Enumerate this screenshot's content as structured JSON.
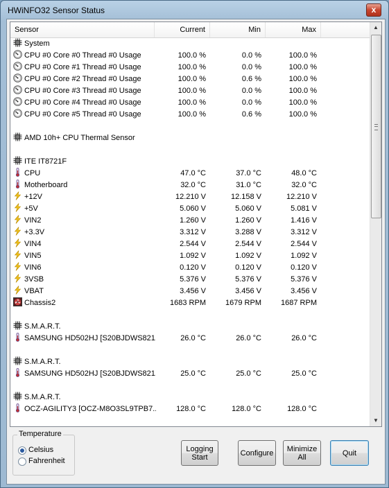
{
  "window": {
    "title": "HWiNFO32 Sensor Status",
    "close_glyph": "x"
  },
  "columns": {
    "sensor": "Sensor",
    "current": "Current",
    "min": "Min",
    "max": "Max"
  },
  "rows": [
    {
      "type": "group",
      "icon": "chip-icon",
      "name": "System",
      "current": "",
      "min": "",
      "max": ""
    },
    {
      "type": "item",
      "icon": "gauge-icon",
      "name": "CPU #0 Core #0 Thread #0 Usage",
      "current": "100.0 %",
      "min": "0.0 %",
      "max": "100.0 %"
    },
    {
      "type": "item",
      "icon": "gauge-icon",
      "name": "CPU #0 Core #1 Thread #0 Usage",
      "current": "100.0 %",
      "min": "0.0 %",
      "max": "100.0 %"
    },
    {
      "type": "item",
      "icon": "gauge-icon",
      "name": "CPU #0 Core #2 Thread #0 Usage",
      "current": "100.0 %",
      "min": "0.6 %",
      "max": "100.0 %"
    },
    {
      "type": "item",
      "icon": "gauge-icon",
      "name": "CPU #0 Core #3 Thread #0 Usage",
      "current": "100.0 %",
      "min": "0.0 %",
      "max": "100.0 %"
    },
    {
      "type": "item",
      "icon": "gauge-icon",
      "name": "CPU #0 Core #4 Thread #0 Usage",
      "current": "100.0 %",
      "min": "0.0 %",
      "max": "100.0 %"
    },
    {
      "type": "item",
      "icon": "gauge-icon",
      "name": "CPU #0 Core #5 Thread #0 Usage",
      "current": "100.0 %",
      "min": "0.6 %",
      "max": "100.0 %"
    },
    {
      "type": "blank",
      "icon": "",
      "name": "",
      "current": "",
      "min": "",
      "max": ""
    },
    {
      "type": "group",
      "icon": "chip-icon",
      "name": "AMD 10h+ CPU Thermal Sensor",
      "current": "",
      "min": "",
      "max": ""
    },
    {
      "type": "blank",
      "icon": "",
      "name": "",
      "current": "",
      "min": "",
      "max": ""
    },
    {
      "type": "group",
      "icon": "chip-icon",
      "name": "ITE IT8721F",
      "current": "",
      "min": "",
      "max": ""
    },
    {
      "type": "item",
      "icon": "thermometer-icon",
      "name": "CPU",
      "current": "47.0 °C",
      "min": "37.0 °C",
      "max": "48.0 °C"
    },
    {
      "type": "item",
      "icon": "thermometer-icon",
      "name": "Motherboard",
      "current": "32.0 °C",
      "min": "31.0 °C",
      "max": "32.0 °C"
    },
    {
      "type": "item",
      "icon": "voltage-icon",
      "name": "+12V",
      "current": "12.210 V",
      "min": "12.158 V",
      "max": "12.210 V"
    },
    {
      "type": "item",
      "icon": "voltage-icon",
      "name": "+5V",
      "current": "5.060 V",
      "min": "5.060 V",
      "max": "5.081 V"
    },
    {
      "type": "item",
      "icon": "voltage-icon",
      "name": "VIN2",
      "current": "1.260 V",
      "min": "1.260 V",
      "max": "1.416 V"
    },
    {
      "type": "item",
      "icon": "voltage-icon",
      "name": "+3.3V",
      "current": "3.312 V",
      "min": "3.288 V",
      "max": "3.312 V"
    },
    {
      "type": "item",
      "icon": "voltage-icon",
      "name": "VIN4",
      "current": "2.544 V",
      "min": "2.544 V",
      "max": "2.544 V"
    },
    {
      "type": "item",
      "icon": "voltage-icon",
      "name": "VIN5",
      "current": "1.092 V",
      "min": "1.092 V",
      "max": "1.092 V"
    },
    {
      "type": "item",
      "icon": "voltage-icon",
      "name": "VIN6",
      "current": "0.120 V",
      "min": "0.120 V",
      "max": "0.120 V"
    },
    {
      "type": "item",
      "icon": "voltage-icon",
      "name": "3VSB",
      "current": "5.376 V",
      "min": "5.376 V",
      "max": "5.376 V"
    },
    {
      "type": "item",
      "icon": "voltage-icon",
      "name": "VBAT",
      "current": "3.456 V",
      "min": "3.456 V",
      "max": "3.456 V"
    },
    {
      "type": "item",
      "icon": "fan-icon",
      "name": "Chassis2",
      "current": "1683 RPM",
      "min": "1679 RPM",
      "max": "1687 RPM"
    },
    {
      "type": "blank",
      "icon": "",
      "name": "",
      "current": "",
      "min": "",
      "max": ""
    },
    {
      "type": "group",
      "icon": "chip-icon",
      "name": "S.M.A.R.T.",
      "current": "",
      "min": "",
      "max": ""
    },
    {
      "type": "item",
      "icon": "thermometer-icon",
      "name": "SAMSUNG HD502HJ [S20BJDWS821...",
      "current": "26.0 °C",
      "min": "26.0 °C",
      "max": "26.0 °C"
    },
    {
      "type": "blank",
      "icon": "",
      "name": "",
      "current": "",
      "min": "",
      "max": ""
    },
    {
      "type": "group",
      "icon": "chip-icon",
      "name": "S.M.A.R.T.",
      "current": "",
      "min": "",
      "max": ""
    },
    {
      "type": "item",
      "icon": "thermometer-icon",
      "name": "SAMSUNG HD502HJ [S20BJDWS821...",
      "current": "25.0 °C",
      "min": "25.0 °C",
      "max": "25.0 °C"
    },
    {
      "type": "blank",
      "icon": "",
      "name": "",
      "current": "",
      "min": "",
      "max": ""
    },
    {
      "type": "group",
      "icon": "chip-icon",
      "name": "S.M.A.R.T.",
      "current": "",
      "min": "",
      "max": ""
    },
    {
      "type": "item",
      "icon": "thermometer-icon",
      "name": "OCZ-AGILITY3 [OCZ-M8O3SL9TPB7...",
      "current": "128.0 °C",
      "min": "128.0 °C",
      "max": "128.0 °C"
    }
  ],
  "temperature": {
    "legend": "Temperature",
    "options": [
      {
        "label": "Celsius",
        "selected": true
      },
      {
        "label": "Fahrenheit",
        "selected": false
      }
    ]
  },
  "buttons": {
    "logging": "Logging\nStart",
    "configure": "Configure",
    "minimize": "Minimize\nAll",
    "quit": "Quit"
  },
  "colors": {
    "accent": "#2b5aa0",
    "close": "#c8462f",
    "voltage": "#f2c21a",
    "thermometer": "#7a4a9a"
  }
}
